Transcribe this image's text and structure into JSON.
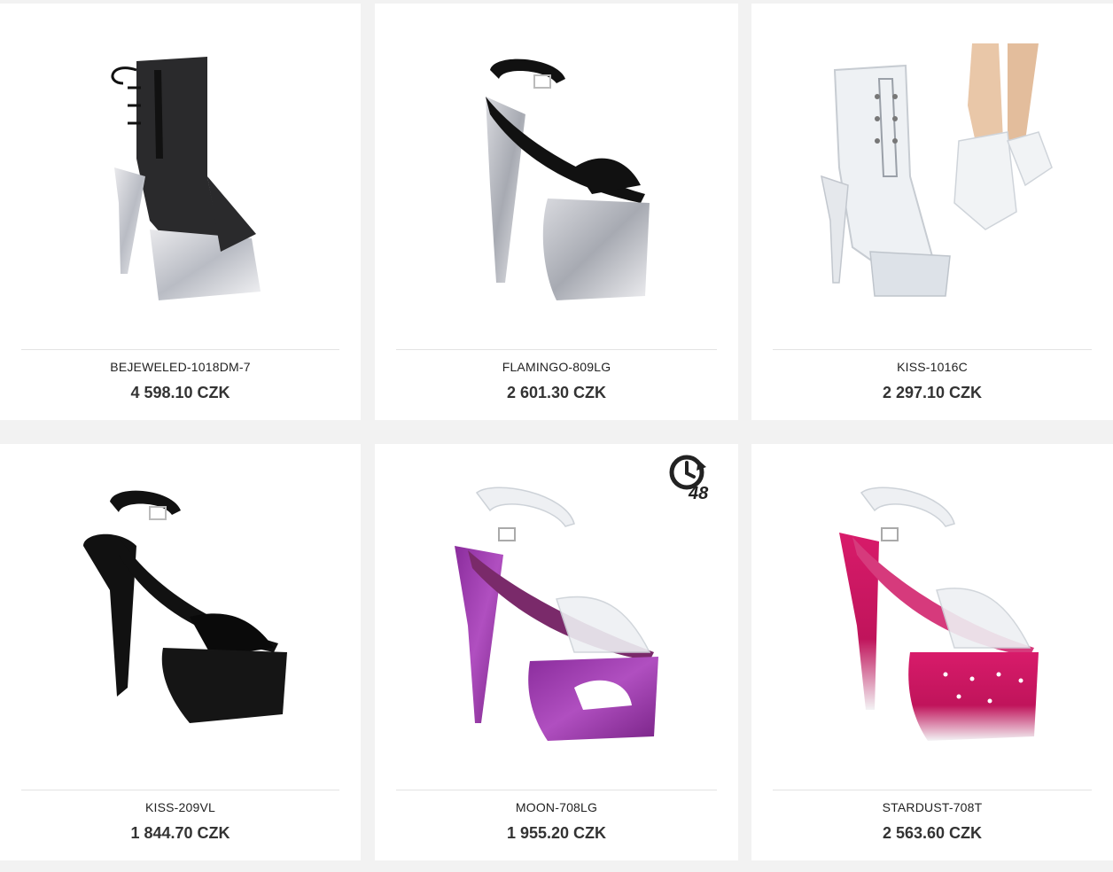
{
  "products": [
    {
      "name": "BEJEWELED-1018DM-7",
      "price": "4 598.10 CZK"
    },
    {
      "name": "FLAMINGO-809LG",
      "price": "2 601.30 CZK"
    },
    {
      "name": "KISS-1016C",
      "price": "2 297.10 CZK"
    },
    {
      "name": "KISS-209VL",
      "price": "1 844.70 CZK"
    },
    {
      "name": "MOON-708LG",
      "price": "1 955.20 CZK",
      "badge": "48"
    },
    {
      "name": "STARDUST-708T",
      "price": "2 563.60 CZK"
    }
  ],
  "icons": {
    "badge_48h": "clock-48h-icon"
  },
  "colors": {
    "background": "#f2f2f2",
    "card": "#ffffff",
    "price_text": "#333333"
  }
}
